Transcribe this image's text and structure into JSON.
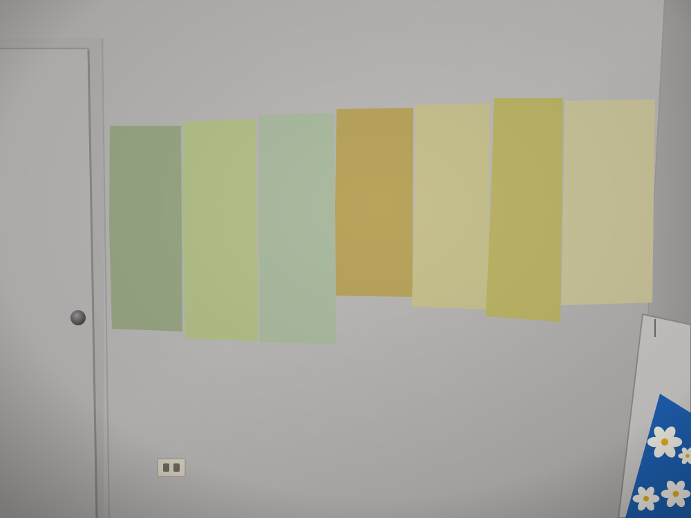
{
  "scene": {
    "wall_color": "#b7b5b3",
    "door_color": "#b9b7b5",
    "swatch_colors": [
      "#9aa886",
      "#b4c189",
      "#abbba0",
      "#b9a45c",
      "#c7c08e",
      "#bbb466",
      "#cac49a"
    ],
    "painting_colors": {
      "background": "#1e5fb0",
      "flower_petal": "#f3f0e6",
      "flower_center": "#e0b020"
    },
    "icons": [
      "door-knob-icon",
      "outlet-icon"
    ]
  }
}
